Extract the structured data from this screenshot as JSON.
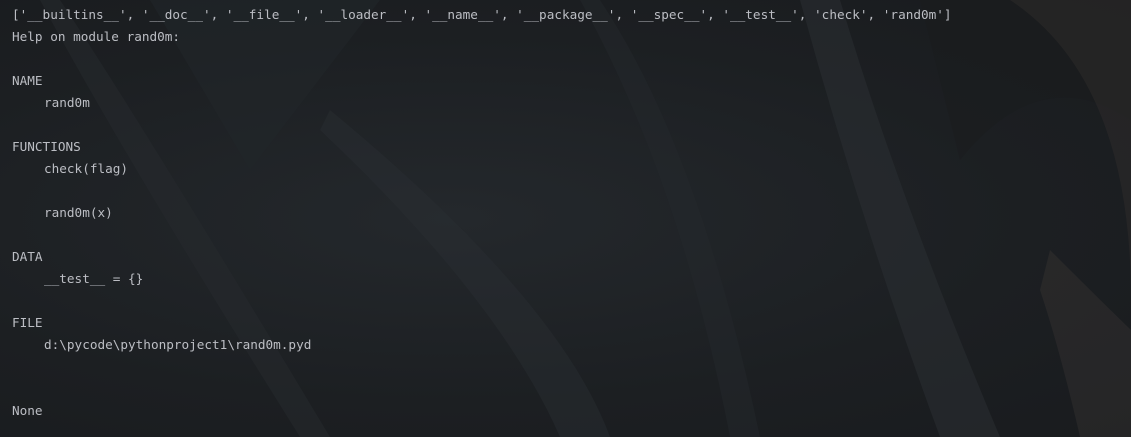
{
  "console": {
    "lines": [
      "['__builtins__', '__doc__', '__file__', '__loader__', '__name__', '__package__', '__spec__', '__test__', 'check', 'rand0m']",
      "Help on module rand0m:",
      "",
      "NAME",
      "rand0m",
      "",
      "FUNCTIONS",
      "check(flag)",
      "",
      "rand0m(x)",
      "",
      "DATA",
      "__test__ = {}",
      "",
      "FILE",
      "d:\\pycode\\pythonproject1\\rand0m.pyd",
      "",
      "",
      "None"
    ]
  },
  "colors": {
    "background": "#1e2124",
    "text": "#bcbec4"
  }
}
